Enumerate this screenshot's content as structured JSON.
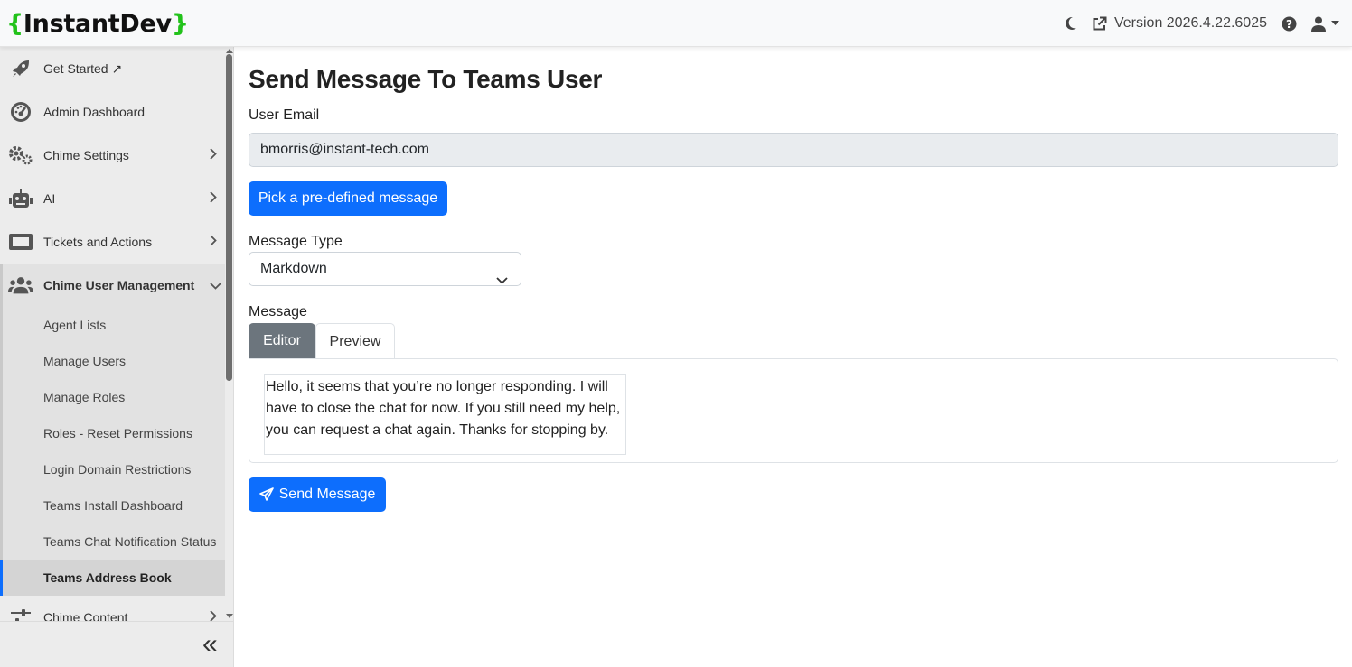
{
  "header": {
    "brand_open": "{",
    "brand_name": "InstantDev",
    "brand_close": "}",
    "version": "Version 2026.4.22.6025",
    "icons": [
      "moon-icon",
      "external-link-icon",
      "help-icon",
      "user-icon",
      "caret-down-icon"
    ]
  },
  "sidebar": {
    "items": [
      {
        "label": "Get Started ↗",
        "icon": "rocket-icon"
      },
      {
        "label": "Admin Dashboard",
        "icon": "gauge-icon"
      },
      {
        "label": "Chime Settings",
        "icon": "gears-icon"
      },
      {
        "label": "AI",
        "icon": "robot-icon"
      },
      {
        "label": "Tickets and Actions",
        "icon": "ticket-icon"
      },
      {
        "label": "Chime User Management",
        "icon": "users-icon"
      },
      {
        "label": "Chime Content",
        "icon": "sliders-icon"
      }
    ],
    "subitems": [
      {
        "label": "Agent Lists"
      },
      {
        "label": "Manage Users"
      },
      {
        "label": "Manage Roles"
      },
      {
        "label": "Roles - Reset Permissions"
      },
      {
        "label": "Login Domain Restrictions"
      },
      {
        "label": "Teams Install Dashboard"
      },
      {
        "label": "Teams Chat Notification Status"
      },
      {
        "label": "Teams Address Book"
      }
    ],
    "collapse_label": "«"
  },
  "main": {
    "title": "Send Message To Teams User",
    "email_label": "User Email",
    "email_value": "bmorris@instant-tech.com",
    "predefined_button": "Pick a pre-defined message",
    "message_type_label": "Message Type",
    "message_type_value": "Markdown",
    "message_label": "Message",
    "tabs": [
      {
        "label": "Editor"
      },
      {
        "label": "Preview"
      }
    ],
    "message_text": "Hello, it seems that you’re no longer responding. I will have to close the chat for now. If you still need my help, you can request a chat again. Thanks for stopping by.",
    "send_button": "Send Message"
  },
  "colors": {
    "primary": "#0d6efd",
    "brand_brace": "#22c21a",
    "tab_active": "#6c757d"
  }
}
